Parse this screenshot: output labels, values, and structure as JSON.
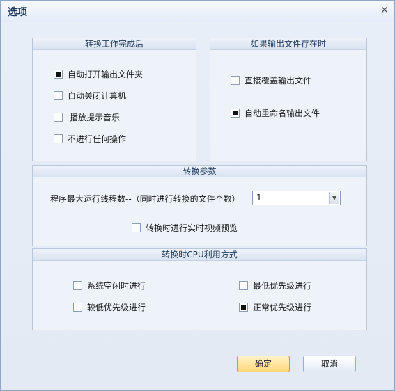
{
  "window": {
    "title": "选项"
  },
  "group_after": {
    "title": "转换工作完成后",
    "options": [
      {
        "label": "自动打开输出文件夹",
        "checked": true
      },
      {
        "label": "自动关闭计算机",
        "checked": false
      },
      {
        "label": "播放提示音乐",
        "checked": false
      },
      {
        "label": "不进行任何操作",
        "checked": false
      }
    ]
  },
  "group_exists": {
    "title": "如果输出文件存在时",
    "options": [
      {
        "label": "直接覆盖输出文件",
        "checked": false
      },
      {
        "label": "自动重命名输出文件",
        "checked": true
      }
    ]
  },
  "group_params": {
    "title": "转换参数",
    "threads_label": "程序最大运行线程数--（同时进行转换的文件个数）",
    "threads_value": "1",
    "preview": {
      "label": "转换时进行实时视频预览",
      "checked": false
    }
  },
  "group_cpu": {
    "title": "转换时CPU利用方式",
    "options": [
      {
        "label": "系统空闲时进行",
        "checked": false
      },
      {
        "label": "最低优先级进行",
        "checked": false
      },
      {
        "label": "较低优先级进行",
        "checked": false
      },
      {
        "label": "正常优先级进行",
        "checked": true
      }
    ]
  },
  "buttons": {
    "ok": "确定",
    "cancel": "取消"
  },
  "icons": {
    "close": "close-icon",
    "dropdown": "chevron-down-icon"
  }
}
